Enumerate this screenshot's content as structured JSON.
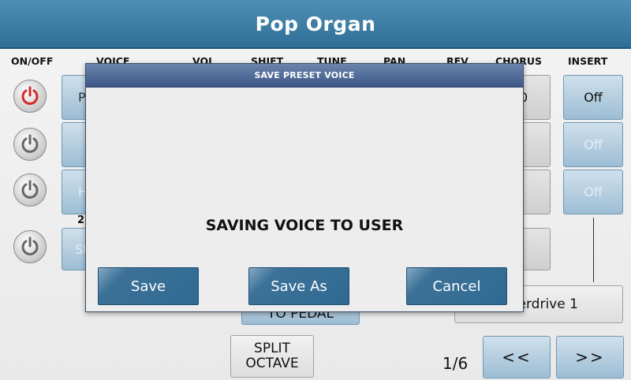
{
  "header": {
    "title": "Pop Organ"
  },
  "columns": [
    "ON/OFF",
    "VOICE",
    "VOL",
    "SHIFT",
    "TUNE",
    "PAN",
    "REV",
    "CHORUS",
    "INSERT"
  ],
  "rows": [
    {
      "power": "on",
      "voice_visible": "P",
      "chorus_visible": "0",
      "insert": "Off"
    },
    {
      "power": "off",
      "voice_visible": "",
      "chorus_visible": "",
      "insert": "Off"
    },
    {
      "power": "off",
      "voice_visible": "H",
      "chorus_visible": "",
      "insert": "Off"
    },
    {
      "power": "off",
      "voice_visible": "St",
      "chorus_visible": "",
      "insert": ""
    }
  ],
  "row_label_partial": "2",
  "insert_effect": "Overdrive 1",
  "to_pedal_label": "TO PEDAL",
  "split_octave_label": "SPLIT\nOCTAVE",
  "page_indicator": "1/6",
  "nav": {
    "prev": "<<",
    "next": ">>"
  },
  "dialog": {
    "title": "SAVE PRESET VOICE",
    "message": "SAVING VOICE TO USER",
    "buttons": {
      "save": "Save",
      "save_as": "Save As",
      "cancel": "Cancel"
    }
  },
  "colors": {
    "title_bar": "#3a7aa3",
    "dialog_header": "#4f6a98",
    "dialog_button": "#2f6a93",
    "power_on": "#d42a2a"
  }
}
